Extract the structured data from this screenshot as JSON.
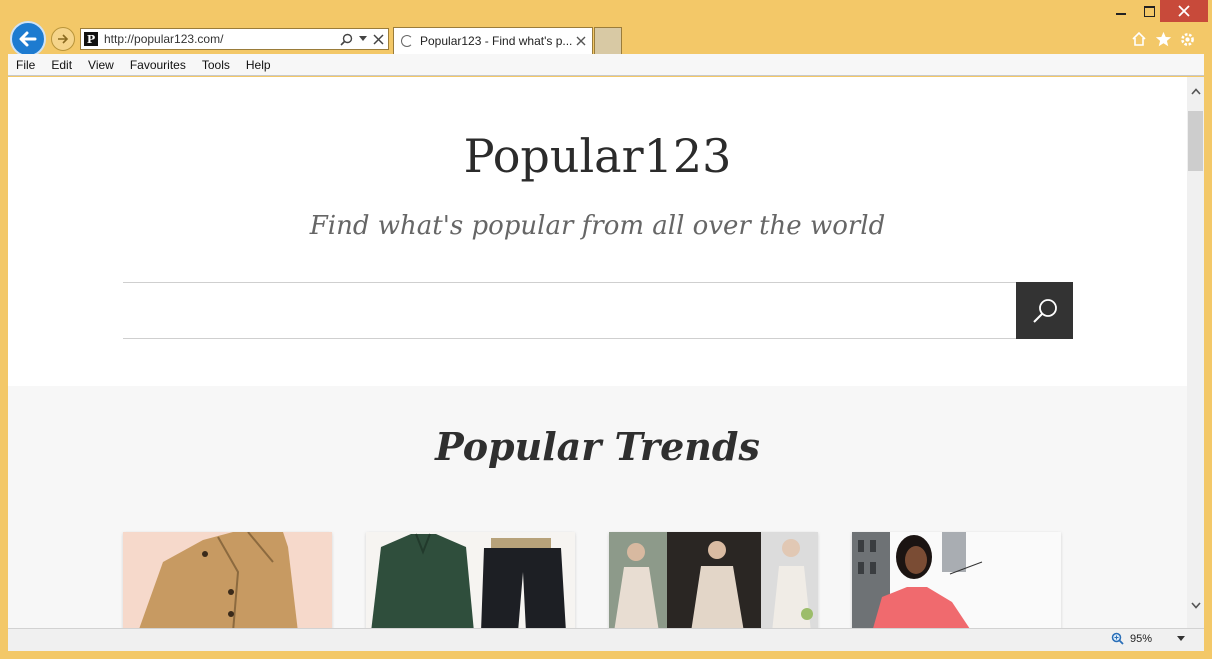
{
  "browser": {
    "url": "http://popular123.com/",
    "tab_title": "Popular123 - Find what's p...",
    "favicon_letter": "P"
  },
  "menu": {
    "items": [
      {
        "label": "File"
      },
      {
        "label": "Edit"
      },
      {
        "label": "View"
      },
      {
        "label": "Favourites"
      },
      {
        "label": "Tools"
      },
      {
        "label": "Help"
      }
    ]
  },
  "page": {
    "logo": "Popular123",
    "tagline": "Find what's popular from all over the world",
    "search_value": "",
    "trends_title": "Popular Trends"
  },
  "status": {
    "zoom": "95%"
  },
  "colors": {
    "frame": "#f3c868",
    "back_button": "#1d7bd0",
    "close_button": "#c84a3a",
    "search_button": "#333333"
  }
}
